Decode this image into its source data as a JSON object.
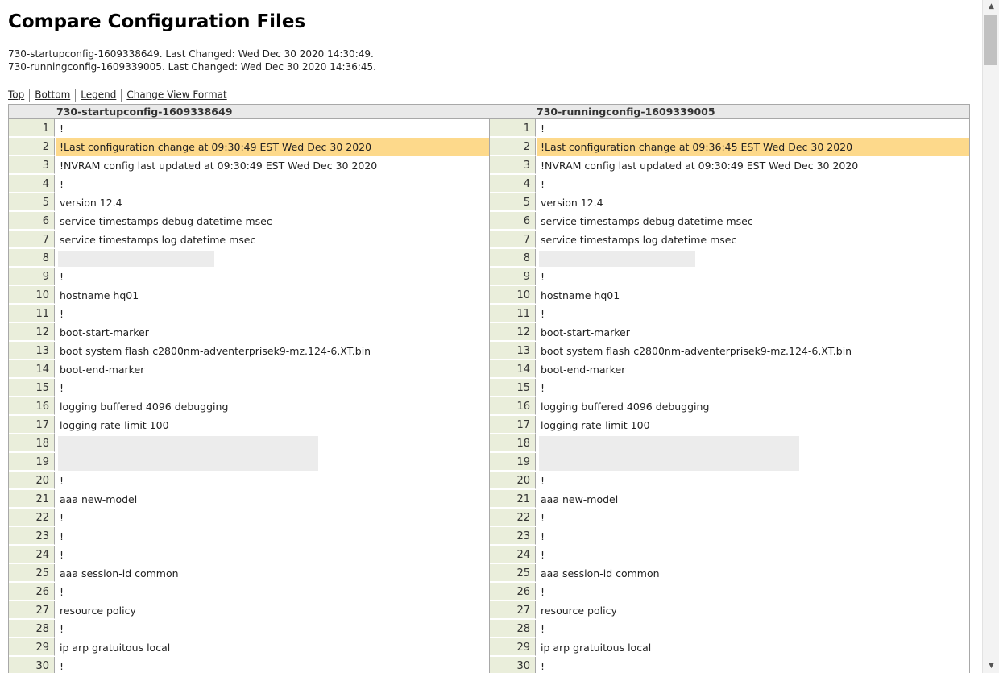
{
  "title": "Compare Configuration Files",
  "meta": [
    "730-startupconfig-1609338649. Last Changed: Wed Dec 30 2020 14:30:49.",
    "730-runningconfig-1609339005. Last Changed: Wed Dec 30 2020 14:36:45."
  ],
  "links": [
    "Top",
    "Bottom",
    "Legend",
    "Change View Format"
  ],
  "left_title": "730-startupconfig-1609338649",
  "right_title": "730-runningconfig-1609339005",
  "left_lines": [
    "!",
    "!Last configuration change at 09:30:49 EST Wed Dec 30 2020",
    "!NVRAM config last updated at 09:30:49 EST Wed Dec 30 2020",
    "!",
    "version 12.4",
    "service timestamps debug datetime msec",
    "service timestamps log datetime msec",
    "",
    "!",
    "hostname hq01",
    "!",
    "boot-start-marker",
    "boot system flash c2800nm-adventerprisek9-mz.124-6.XT.bin",
    "boot-end-marker",
    "!",
    "logging buffered 4096 debugging",
    "logging rate-limit 100",
    "",
    "",
    "!",
    "aaa new-model",
    "!",
    "!",
    "!",
    "aaa session-id common",
    "!",
    "resource policy",
    "!",
    "ip arp gratuitous local",
    "!"
  ],
  "right_lines": [
    "!",
    "!Last configuration change at 09:36:45 EST Wed Dec 30 2020",
    "!NVRAM config last updated at 09:30:49 EST Wed Dec 30 2020",
    "!",
    "version 12.4",
    "service timestamps debug datetime msec",
    "service timestamps log datetime msec",
    "",
    "!",
    "hostname hq01",
    "!",
    "boot-start-marker",
    "boot system flash c2800nm-adventerprisek9-mz.124-6.XT.bin",
    "boot-end-marker",
    "!",
    "logging buffered 4096 debugging",
    "logging rate-limit 100",
    "",
    "",
    "!",
    "aaa new-model",
    "!",
    "!",
    "!",
    "aaa session-id common",
    "!",
    "resource policy",
    "!",
    "ip arp gratuitous local",
    "!"
  ],
  "changed_lines": [
    2
  ],
  "redacted_lines": [
    8,
    18,
    19
  ],
  "colors": {
    "changed": "#fdd98b",
    "gutter": "#eaeedb",
    "header": "#e9e9e9"
  }
}
